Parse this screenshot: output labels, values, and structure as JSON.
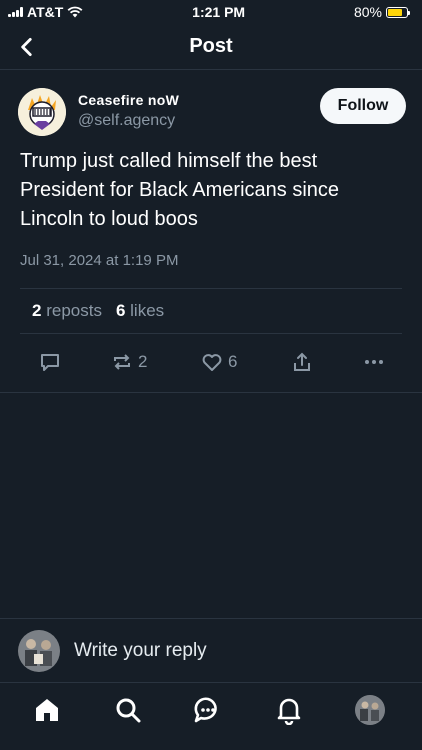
{
  "status_bar": {
    "carrier": "AT&T",
    "time": "1:21 PM",
    "battery_pct": "80%",
    "battery_level": 0.8,
    "battery_color": "#ffd60a"
  },
  "header": {
    "title": "Post"
  },
  "post": {
    "author_display_name": "Ceasefire noW",
    "author_handle": "@self.agency",
    "follow_label": "Follow",
    "text": "Trump just called himself the best President for Black Americans since Lincoln to loud boos",
    "timestamp": "Jul 31, 2024 at 1:19 PM",
    "stats": {
      "reposts_count": "2",
      "reposts_label": "reposts",
      "likes_count": "6",
      "likes_label": "likes"
    },
    "actions": {
      "repost_count": "2",
      "like_count": "6"
    }
  },
  "reply_bar": {
    "placeholder": "Write your reply"
  },
  "tab_bar": {
    "items": [
      "home-icon",
      "search-icon",
      "chat-icon",
      "bell-icon",
      "profile-avatar"
    ]
  },
  "colors": {
    "background": "#161e27",
    "divider": "#2a3440",
    "muted_text": "#8b98a5",
    "follow_button_bg": "#f5f8fa"
  }
}
